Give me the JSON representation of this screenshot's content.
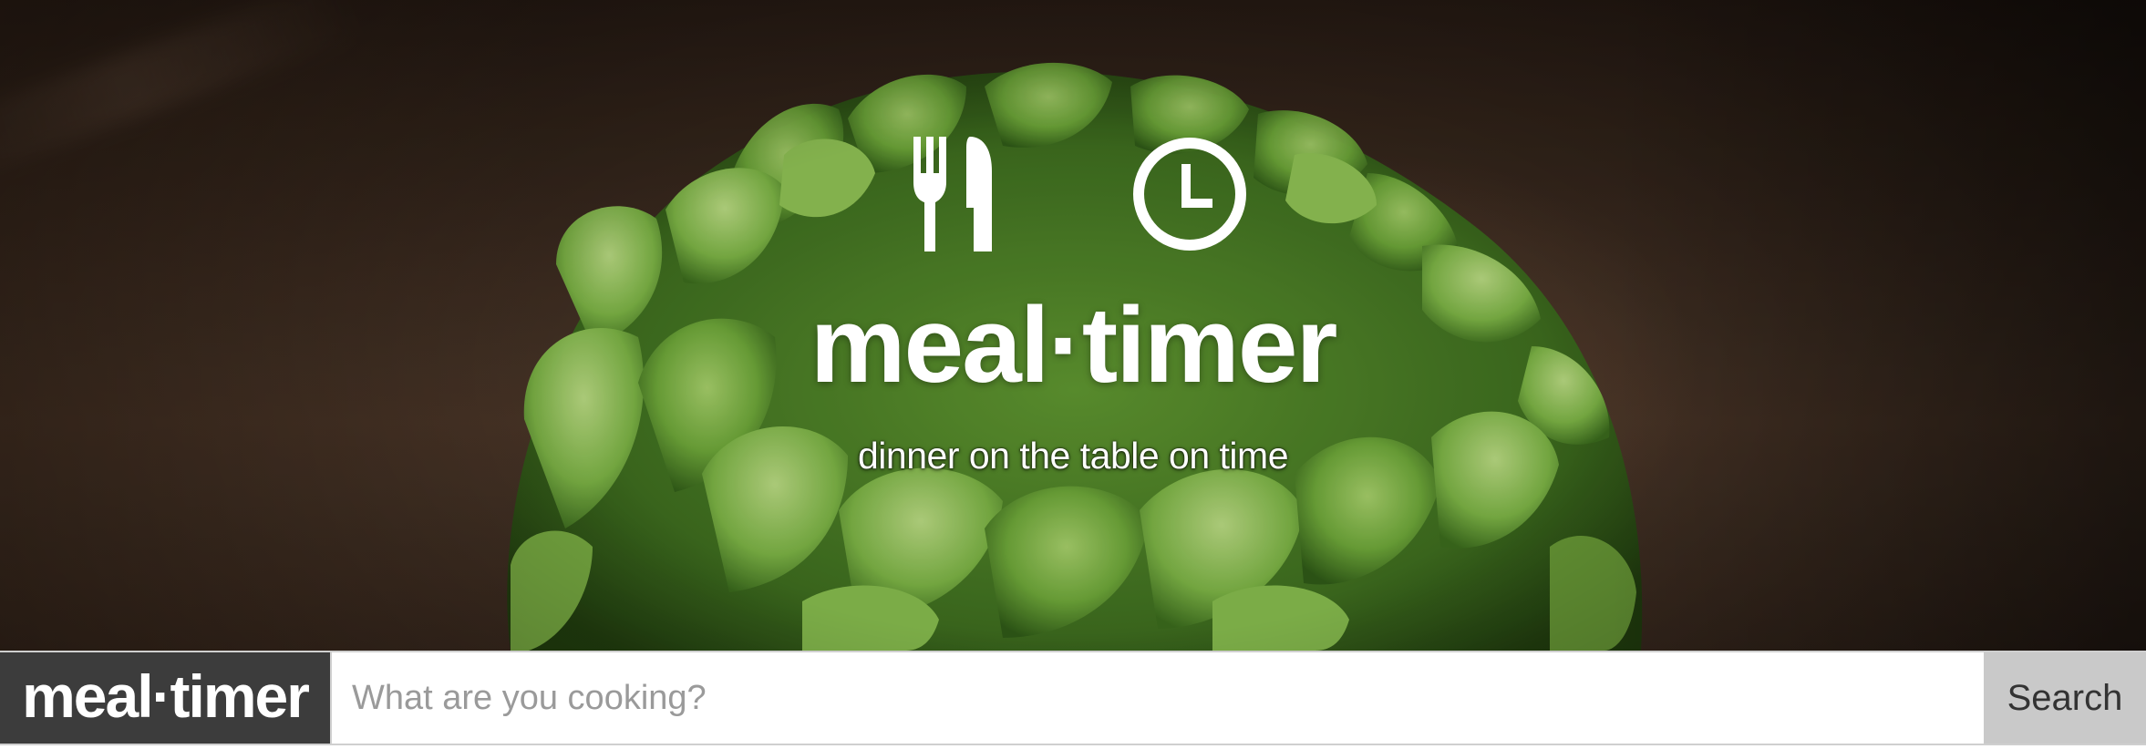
{
  "hero": {
    "title": "meal·timer",
    "tagline": "dinner on the table on time",
    "logo_icons": [
      "fork-knife-icon",
      "clock-icon"
    ]
  },
  "search": {
    "brand_label": "meal·timer",
    "placeholder": "What are you cooking?",
    "value": "",
    "button_label": "Search"
  },
  "colors": {
    "brand_box_bg": "#3c3c3c",
    "button_bg": "#c9c9c9",
    "hero_text": "#ffffff"
  }
}
